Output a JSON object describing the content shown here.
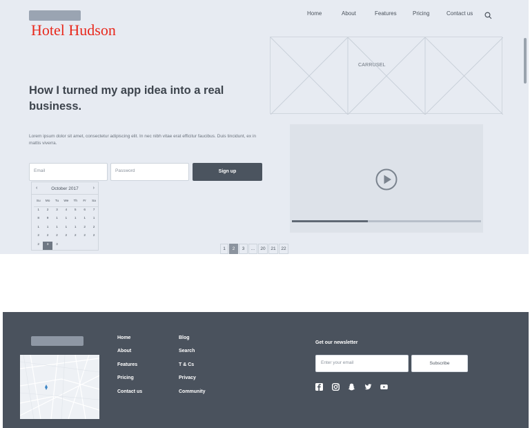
{
  "brand": {
    "name": "Hotel Hudson"
  },
  "nav": {
    "items": [
      {
        "label": "Home"
      },
      {
        "label": "About"
      },
      {
        "label": "Features"
      },
      {
        "label": "Pricing"
      },
      {
        "label": "Contact us"
      }
    ]
  },
  "carousel": {
    "label": "CARRUSEL"
  },
  "hero": {
    "headline": "How I turned my app idea into a real business.",
    "lorem": "Lorem ipsum dolor sit amet, consectetur adipiscing elit. In nec nibh vitae erat efficitur faucibus. Duis tincidunt, ex in mattis viverra."
  },
  "form": {
    "email_placeholder": "Email",
    "password_placeholder": "Password",
    "signup_label": "Sign up"
  },
  "calendar": {
    "title": "October 2017",
    "prev": "‹",
    "next": "›",
    "weekdays": [
      "Su",
      "Mo",
      "Tu",
      "We",
      "Th",
      "Fr",
      "Sa"
    ],
    "rows": [
      [
        "1",
        "2",
        "3",
        "4",
        "5",
        "6",
        "7"
      ],
      [
        "8",
        "9",
        "1",
        "1",
        "1",
        "1",
        "1"
      ],
      [
        "1",
        "1",
        "1",
        "1",
        "1",
        "2",
        "2"
      ],
      [
        "2",
        "2",
        "2",
        "2",
        "2",
        "2",
        "2"
      ],
      [
        "2",
        "3",
        "3",
        "",
        "",
        "",
        ""
      ]
    ],
    "selected": "2"
  },
  "pagination": {
    "pages": [
      "1",
      "2",
      "3",
      "...",
      "20",
      "21",
      "22"
    ],
    "active": "2"
  },
  "video": {
    "progress": 0.4
  },
  "footer": {
    "links_col1": [
      "Home",
      "About",
      "Features",
      "Pricing",
      "Contact us"
    ],
    "links_col2": [
      "Blog",
      "Search",
      "T & Cs",
      "Privacy",
      "Community"
    ],
    "newsletter_title": "Get our newsletter",
    "email_placeholder": "Enter your email",
    "subscribe_label": "Subscribe",
    "social_icons": [
      "facebook-icon",
      "instagram-icon",
      "snapchat-icon",
      "twitter-icon",
      "youtube-icon"
    ]
  },
  "colors": {
    "hero_bg": "#e7ebf2",
    "footer_bg": "#4a525d",
    "brand": "#e8281c",
    "button_dark": "#4b545f"
  }
}
